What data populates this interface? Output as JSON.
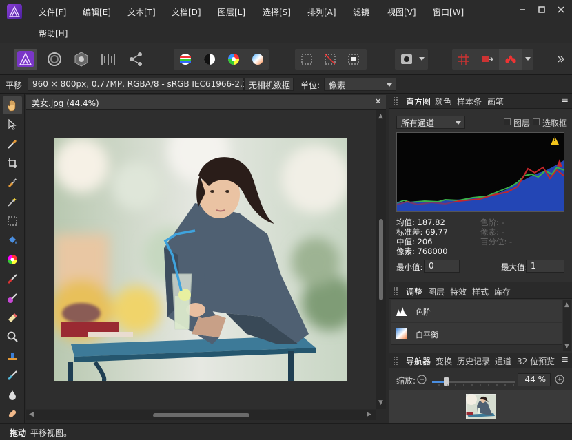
{
  "menu": {
    "items": [
      "文件[F]",
      "编辑[E]",
      "文本[T]",
      "文档[D]",
      "图层[L]",
      "选择[S]",
      "排列[A]",
      "滤镜",
      "视图[V]",
      "窗口[W]"
    ],
    "help": "帮助[H]",
    "window_controls": [
      "minimize-icon",
      "maximize-icon",
      "close-icon"
    ]
  },
  "context": {
    "tool_name": "平移",
    "doc_info": "960 × 800px, 0.77MP, RGBA/8 - sRGB IEC61966-2.1",
    "camera_data": "无相机数据",
    "unit_label": "单位:",
    "unit_value": "像素"
  },
  "document": {
    "tab_title": "美女.jpg (44.4%)",
    "close_glyph": "×"
  },
  "histogram_panel": {
    "tabs": [
      "直方图",
      "颜色",
      "样本条",
      "画笔"
    ],
    "channel_select": "所有通道",
    "layer_label": "图层",
    "marquee_label": "选取框",
    "stats": {
      "mean": "均值: 187.82",
      "std": "标准差: 69.77",
      "median": "中值: 206",
      "pixels": "像素: 768000",
      "level": "色阶: -",
      "count": "像素: -",
      "percentile": "百分位: -"
    },
    "min_label": "最小值:",
    "min_value": "0",
    "max_label": "最大值:",
    "max_value": "1",
    "warning_glyph": "!"
  },
  "adjustment_panel": {
    "tabs": [
      "调整",
      "图层",
      "特效",
      "样式",
      "库存"
    ],
    "items": [
      "色阶",
      "白平衡"
    ]
  },
  "navigator_panel": {
    "tabs": [
      "导航器",
      "变换",
      "历史记录",
      "通道",
      "32 位预览"
    ],
    "zoom_label": "缩放:",
    "zoom_value": "44 %",
    "zoom_fraction": 0.17
  },
  "status": {
    "mode": "拖动",
    "message": "平移视图。"
  },
  "colors": {
    "accent": "#8a3fd6",
    "background": "#2a2a2a",
    "panel": "#303030"
  }
}
